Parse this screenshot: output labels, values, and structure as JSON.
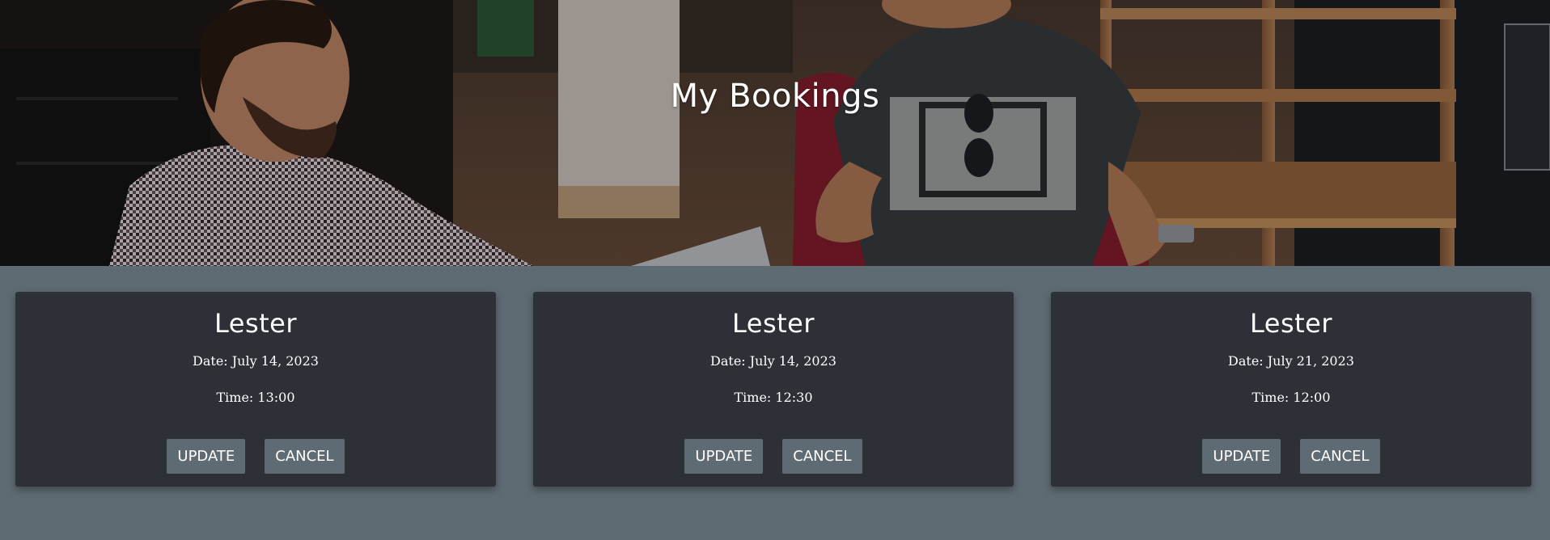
{
  "header": {
    "title": "My Bookings"
  },
  "bookings": [
    {
      "name": "Lester",
      "date": "Date: July 14, 2023",
      "time": "Time: 13:00",
      "update_label": "UPDATE",
      "cancel_label": "CANCEL"
    },
    {
      "name": "Lester",
      "date": "Date: July 14, 2023",
      "time": "Time: 12:30",
      "update_label": "UPDATE",
      "cancel_label": "CANCEL"
    },
    {
      "name": "Lester",
      "date": "Date: July 21, 2023",
      "time": "Time: 12:00",
      "update_label": "UPDATE",
      "cancel_label": "CANCEL"
    }
  ],
  "colors": {
    "page_background": "#5f6b72",
    "card_background": "#2d3037",
    "button_background": "#5f6b72",
    "text": "#ffffff"
  }
}
